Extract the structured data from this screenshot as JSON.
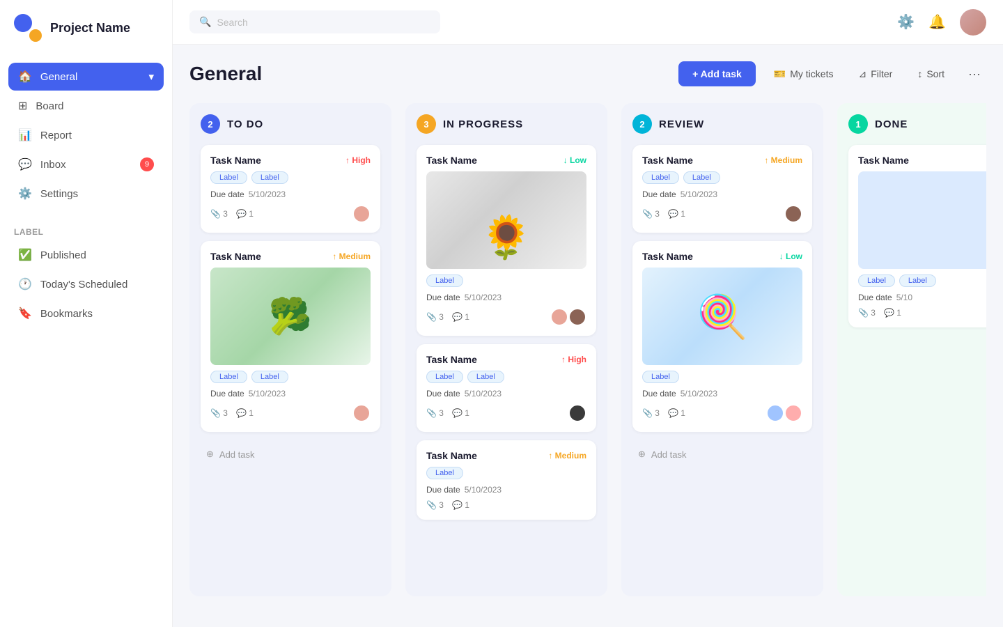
{
  "app": {
    "project_name": "Project Name",
    "logo_icon": "project-logo"
  },
  "sidebar": {
    "nav_items": [
      {
        "id": "general",
        "label": "General",
        "icon": "home-icon",
        "active": true,
        "has_chevron": true
      },
      {
        "id": "board",
        "label": "Board",
        "icon": "grid-icon",
        "active": false
      },
      {
        "id": "report",
        "label": "Report",
        "icon": "bar-chart-icon",
        "active": false
      },
      {
        "id": "inbox",
        "label": "Inbox",
        "icon": "message-icon",
        "active": false,
        "badge": "9"
      },
      {
        "id": "settings",
        "label": "Settings",
        "icon": "settings-icon",
        "active": false
      }
    ],
    "label_section": "Label",
    "label_items": [
      {
        "id": "published",
        "label": "Published",
        "icon": "check-circle-icon"
      },
      {
        "id": "scheduled",
        "label": "Today's Scheduled",
        "icon": "clock-icon"
      },
      {
        "id": "bookmarks",
        "label": "Bookmarks",
        "icon": "bookmark-icon"
      }
    ]
  },
  "header": {
    "search_placeholder": "Search"
  },
  "toolbar": {
    "add_task_label": "+ Add task",
    "my_tickets_label": "My tickets",
    "filter_label": "Filter",
    "sort_label": "Sort"
  },
  "page": {
    "title": "General"
  },
  "columns": [
    {
      "id": "todo",
      "badge_count": "2",
      "badge_color": "blue",
      "title": "TO DO",
      "cards": [
        {
          "id": "t1",
          "name": "Task Name",
          "priority": "High",
          "priority_level": "high",
          "labels": [
            "Label",
            "Label"
          ],
          "due_date": "5/10/2023",
          "attachments": "3",
          "comments": "1",
          "avatar": "pink"
        },
        {
          "id": "t2",
          "name": "Task Name",
          "priority": "Medium",
          "priority_level": "medium",
          "has_image": true,
          "image_type": "greens",
          "labels": [
            "Label",
            "Label"
          ],
          "due_date": "5/10/2023",
          "attachments": "3",
          "comments": "1",
          "avatar": "pink"
        }
      ],
      "add_task_label": "Add task"
    },
    {
      "id": "inprogress",
      "badge_count": "3",
      "badge_color": "orange",
      "title": "IN PROGRESS",
      "cards": [
        {
          "id": "p1",
          "name": "Task Name",
          "priority": "Low",
          "priority_level": "low",
          "has_image": true,
          "image_type": "flower",
          "labels": [
            "Label"
          ],
          "due_date": "5/10/2023",
          "attachments": "3",
          "comments": "1",
          "avatars": [
            "pink",
            "brown"
          ]
        },
        {
          "id": "p2",
          "name": "Task Name",
          "priority": "High",
          "priority_level": "high",
          "labels": [
            "Label",
            "Label"
          ],
          "due_date": "5/10/2023",
          "attachments": "3",
          "comments": "1",
          "avatar": "dark"
        },
        {
          "id": "p3",
          "name": "Task Name",
          "priority": "Medium",
          "priority_level": "medium",
          "labels": [
            "Label"
          ],
          "due_date": "5/10/2023",
          "attachments": "3",
          "comments": "1"
        }
      ]
    },
    {
      "id": "review",
      "badge_count": "2",
      "badge_color": "teal",
      "title": "REVIEW",
      "cards": [
        {
          "id": "r1",
          "name": "Task Name",
          "priority": "Medium",
          "priority_level": "medium",
          "labels": [
            "Label",
            "Label"
          ],
          "due_date": "5/10/2023",
          "attachments": "3",
          "comments": "1",
          "avatar": "brown"
        },
        {
          "id": "r2",
          "name": "Task Name",
          "priority": "Low",
          "priority_level": "low",
          "has_image": true,
          "image_type": "candy",
          "labels": [
            "Label"
          ],
          "due_date": "5/10/2023",
          "attachments": "3",
          "comments": "1",
          "avatars": [
            "multi1",
            "multi2"
          ]
        }
      ],
      "add_task_label": "Add task"
    },
    {
      "id": "done",
      "badge_count": "1",
      "badge_color": "green",
      "title": "DONE",
      "cards": [
        {
          "id": "d1",
          "name": "Task Name",
          "has_image_placeholder": true,
          "labels": [
            "Label",
            "Label"
          ],
          "due_date": "5/10",
          "attachments": "3",
          "comments": "1"
        }
      ]
    }
  ],
  "icons": {
    "home": "⌂",
    "grid": "⊞",
    "chart": "📊",
    "message": "💬",
    "settings": "⚙",
    "check": "✓",
    "clock": "🕐",
    "bookmark": "🔖",
    "search": "🔍",
    "bell": "🔔",
    "gear": "⚙",
    "arrow_up": "↑",
    "arrow_down": "↓",
    "paperclip": "📎",
    "comment": "💬",
    "plus_circle": "⊕",
    "ticket": "🎫",
    "filter": "⊿",
    "sort": "↕",
    "more": "···"
  }
}
